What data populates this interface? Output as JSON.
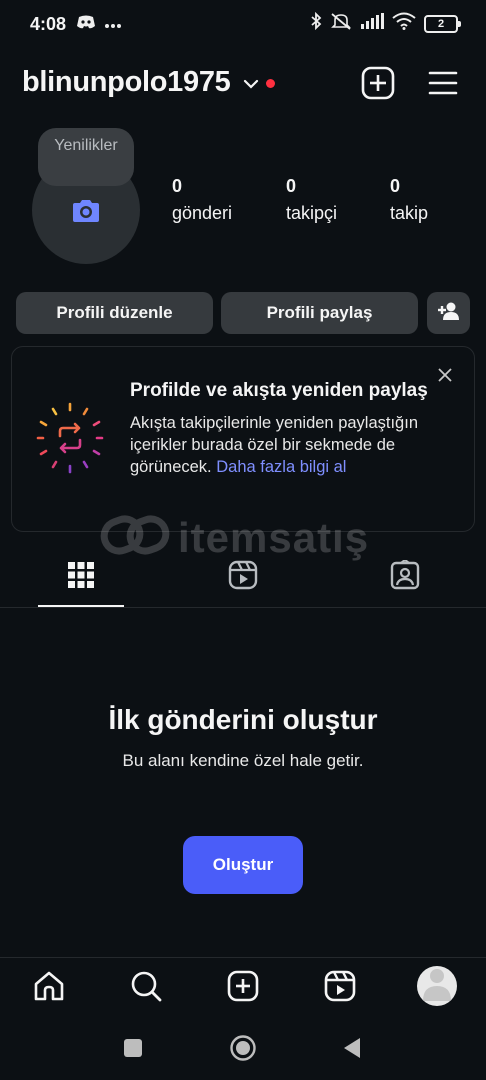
{
  "status_bar": {
    "time": "4:08",
    "battery": "2",
    "icons": [
      "discord-icon",
      "more-dots-icon",
      "bluetooth-icon",
      "mute-icon",
      "signal-icon",
      "wifi-icon",
      "battery-icon"
    ]
  },
  "header": {
    "username": "blinunpolo1975",
    "icons": [
      "chevron-down-icon",
      "new-post-icon",
      "menu-icon"
    ],
    "notification_color": "#ff3040"
  },
  "profile": {
    "note": "Yenilikler",
    "stats": [
      {
        "value": "0",
        "label": "gönderi"
      },
      {
        "value": "0",
        "label": "takipçi"
      },
      {
        "value": "0",
        "label": "takip"
      }
    ]
  },
  "buttons": {
    "edit_profile": "Profili düzenle",
    "share_profile": "Profili paylaş"
  },
  "card": {
    "title": "Profilde ve akışta yeniden paylaş",
    "body": "Akışta takipçilerinle yeniden paylaştığın içerikler burada özel bir sekmede de görünecek. ",
    "link": "Daha fazla bilgi al"
  },
  "watermark": {
    "text": "itemsatış"
  },
  "tabs": [
    "grid-icon",
    "reels-icon",
    "tagged-icon"
  ],
  "empty_state": {
    "title": "İlk gönderini oluştur",
    "subtitle": "Bu alanı kendine özel hale getir.",
    "button": "Oluştur"
  },
  "bottom_nav": [
    "home-icon",
    "search-icon",
    "create-icon",
    "reels-icon",
    "profile-avatar"
  ],
  "colors": {
    "background": "#0c1014",
    "button": "#363a3e",
    "accent": "#4a5df9",
    "link": "#7f8fff"
  }
}
